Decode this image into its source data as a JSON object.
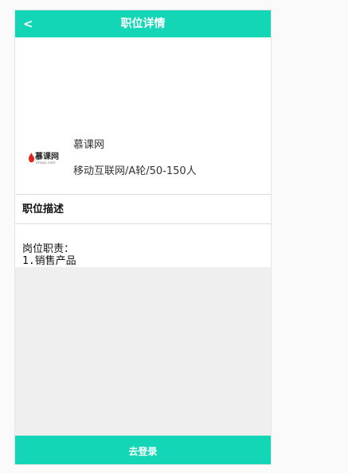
{
  "header": {
    "back_label": "<",
    "title": "职位详情"
  },
  "company": {
    "logo_text": "慕课网",
    "logo_subtext": "imooc.com",
    "name": "慕课网",
    "meta": "移动互联网/A轮/50-150人"
  },
  "section": {
    "title": "职位描述"
  },
  "description": {
    "lines": [
      "岗位职责：",
      "1.销售产品"
    ]
  },
  "footer": {
    "login_label": "去登录"
  },
  "colors": {
    "accent": "#12d6b6",
    "logo_red": "#e2231a"
  }
}
